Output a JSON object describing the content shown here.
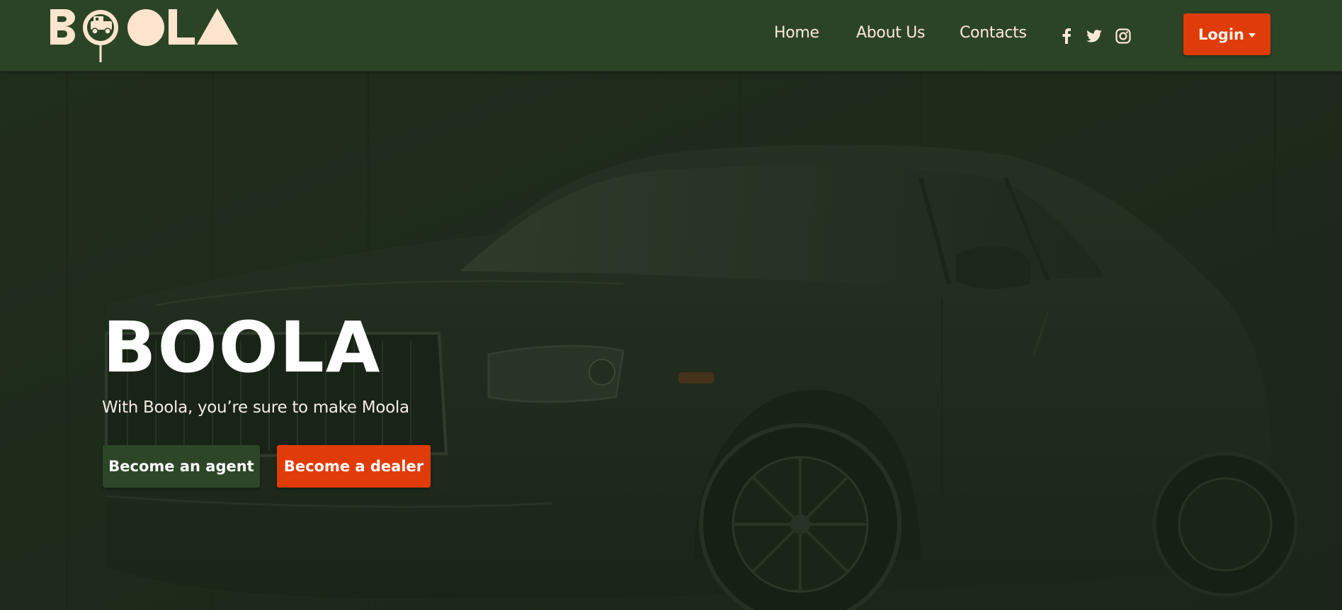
{
  "header": {
    "logo_text": "BOOLA",
    "nav": {
      "home": "Home",
      "about": "About Us",
      "contacts": "Contacts"
    },
    "social_icons": [
      "facebook-icon",
      "twitter-icon",
      "instagram-icon"
    ],
    "login_label": "Login"
  },
  "hero": {
    "title": "BOOLA",
    "subtitle": "With Boola, you’re sure to make Moola",
    "agent_button": "Become an agent",
    "dealer_button": "Become a dealer",
    "background_image": "dark car"
  },
  "colors": {
    "navbar": "#2c4426",
    "accent": "#e03c0a",
    "logo": "#ffe5cf",
    "agent_button": "#2d4628"
  }
}
